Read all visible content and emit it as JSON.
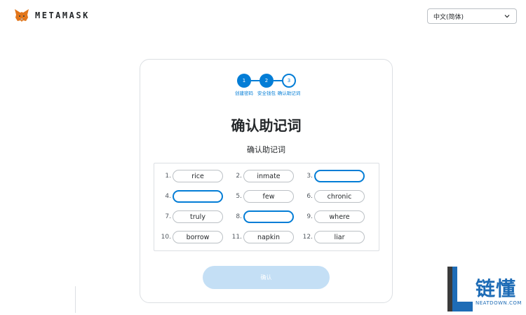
{
  "header": {
    "brand": "METAMASK",
    "language": "中文(简体)"
  },
  "stepper": {
    "steps": [
      {
        "num": "1",
        "label": "创建密码"
      },
      {
        "num": "2",
        "label": "安全钱包"
      },
      {
        "num": "3",
        "label": "确认助记词"
      }
    ],
    "current": 3
  },
  "main": {
    "title": "确认助记词",
    "subtitle": "确认助记词",
    "words": [
      {
        "num": "1.",
        "word": "rice"
      },
      {
        "num": "2.",
        "word": "inmate"
      },
      {
        "num": "3.",
        "word": ""
      },
      {
        "num": "4.",
        "word": ""
      },
      {
        "num": "5.",
        "word": "few"
      },
      {
        "num": "6.",
        "word": "chronic"
      },
      {
        "num": "7.",
        "word": "truly"
      },
      {
        "num": "8.",
        "word": ""
      },
      {
        "num": "9.",
        "word": "where"
      },
      {
        "num": "10.",
        "word": "borrow"
      },
      {
        "num": "11.",
        "word": "napkin"
      },
      {
        "num": "12.",
        "word": "liar"
      }
    ],
    "confirm_label": "确认"
  },
  "watermark": {
    "cn": "链懂",
    "en": "NEATDOWN.COM"
  },
  "colors": {
    "accent": "#037dd6",
    "button_disabled": "#c4dff5",
    "watermark": "#1e6cb6"
  }
}
